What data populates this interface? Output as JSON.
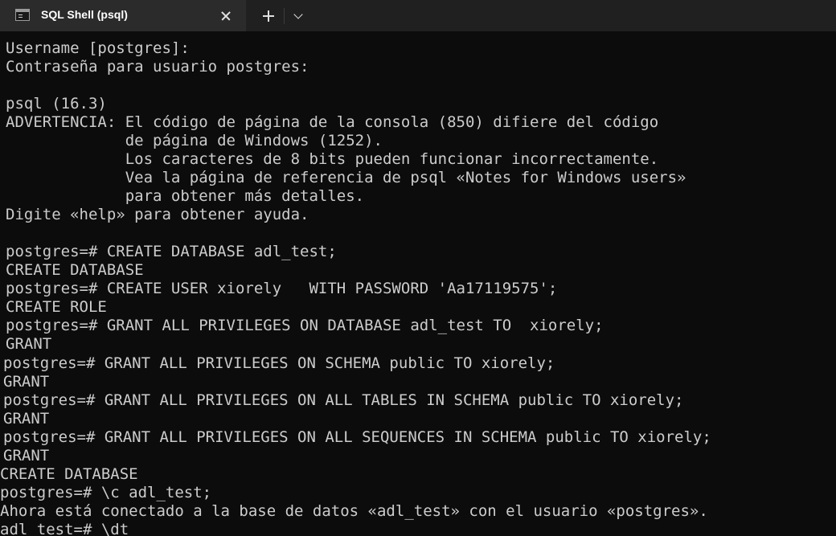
{
  "window": {
    "tab_title": "SQL Shell (psql)"
  },
  "terminal": {
    "lines": [
      "Username [postgres]:",
      "Contraseña para usuario postgres:",
      "",
      "psql (16.3)",
      "ADVERTENCIA: El código de página de la consola (850) difiere del código",
      "             de página de Windows (1252).",
      "             Los caracteres de 8 bits pueden funcionar incorrectamente.",
      "             Vea la página de referencia de psql «Notes for Windows users»",
      "             para obtener más detalles.",
      "Digite «help» para obtener ayuda.",
      "",
      "postgres=# CREATE DATABASE adl_test;",
      "CREATE DATABASE",
      "postgres=# CREATE USER xiorely   WITH PASSWORD 'Aa17119575';",
      "CREATE ROLE",
      "postgres=# GRANT ALL PRIVILEGES ON DATABASE adl_test TO  xiorely;",
      "GRANT",
      "postgres=# GRANT ALL PRIVILEGES ON SCHEMA public TO xiorely;",
      "GRANT",
      "postgres=# GRANT ALL PRIVILEGES ON ALL TABLES IN SCHEMA public TO xiorely;",
      "GRANT",
      "postgres=# GRANT ALL PRIVILEGES ON ALL SEQUENCES IN SCHEMA public TO xiorely;",
      "GRANT",
      "CREATE DATABASE",
      "postgres=# \\c adl_test;",
      "Ahora está conectado a la base de datos «adl_test» con el usuario «postgres».",
      "adl_test=# \\dt"
    ]
  }
}
